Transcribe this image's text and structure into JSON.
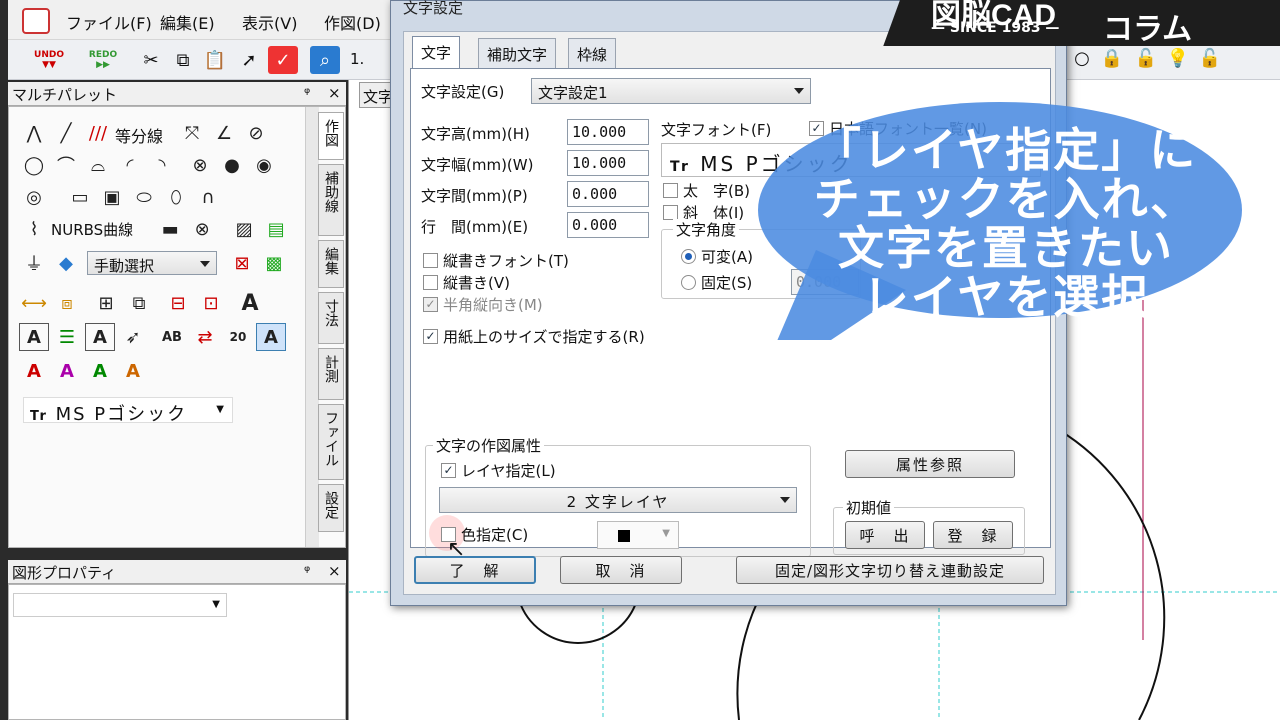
{
  "menu": {
    "file": "ファイル(F)",
    "edit": "編集(E)",
    "view": "表示(V)",
    "draw": "作図(D)",
    "num": "1."
  },
  "toolbar": {
    "undo": "UNDO",
    "redo": "REDO"
  },
  "palette": {
    "title": "マルチパレット",
    "pin": "ᵠ",
    "close": "×",
    "row1_text": "等分線",
    "nurbs": "NURBS曲線",
    "select_combo": "手動選択",
    "font_combo": "MS Pゴシック",
    "font_icon": "Tr"
  },
  "side_tabs": [
    "作図",
    "補助線",
    "編集",
    "寸法",
    "計測",
    "ファイル",
    "設定"
  ],
  "prop": {
    "title": "図形プロパティ",
    "pin": "ᵠ",
    "close": "×"
  },
  "canvas": {
    "tab_label": "文字"
  },
  "dialog": {
    "title": "文字設定",
    "tabs": [
      "文字",
      "補助文字",
      "枠線"
    ],
    "setting_label": "文字設定(G)",
    "setting_value": "文字設定1",
    "height_label": "文字高(mm)(H)",
    "height_value": "10.000",
    "width_label": "文字幅(mm)(W)",
    "width_value": "10.000",
    "spacing_label": "文字間(mm)(P)",
    "spacing_value": "0.000",
    "line_label": "行　間(mm)(E)",
    "line_value": "0.000",
    "vfont_label": "縦書きフォント(T)",
    "vertical_label": "縦書き(V)",
    "halfwidth_label": "半角縦向き(M)",
    "papersize_label": "用紙上のサイズで指定する(R)",
    "font_label": "文字フォント(F)",
    "font_value": "MS Pゴシック",
    "font_icon": "Tr",
    "jpfont_label": "日本語フォント一覧(N)",
    "bold_label": "太　字(B)",
    "italic_label": "斜　体(I)",
    "angle_group": "文字角度",
    "angle_var": "可変(A)",
    "angle_fix": "固定(S)",
    "angle_value": "0.000",
    "attr_group": "文字の作図属性",
    "layer_label": "レイヤ指定(L)",
    "layer_value": "2 文字レイヤ",
    "color_label": "色指定(C)",
    "attr_ref": "属性参照",
    "initial_group": "初期値",
    "recall": "呼　出",
    "register": "登　録",
    "ok": "了　解",
    "cancel": "取　消",
    "link_setting": "固定/図形文字切り替え連動設定"
  },
  "overlay": {
    "brand_top": "図脳CAD",
    "brand_since": "— SINCE 1983 —",
    "brand_col": "コラム",
    "bubble_lines": [
      "「レイヤ指定」に",
      "チェックを入れ、",
      "文字を置きたい",
      "レイヤを選択"
    ]
  },
  "colors": {
    "bubble": "#4b8be0",
    "accent": "#3c7fb1",
    "brand_bg": "#1d1d1d"
  }
}
